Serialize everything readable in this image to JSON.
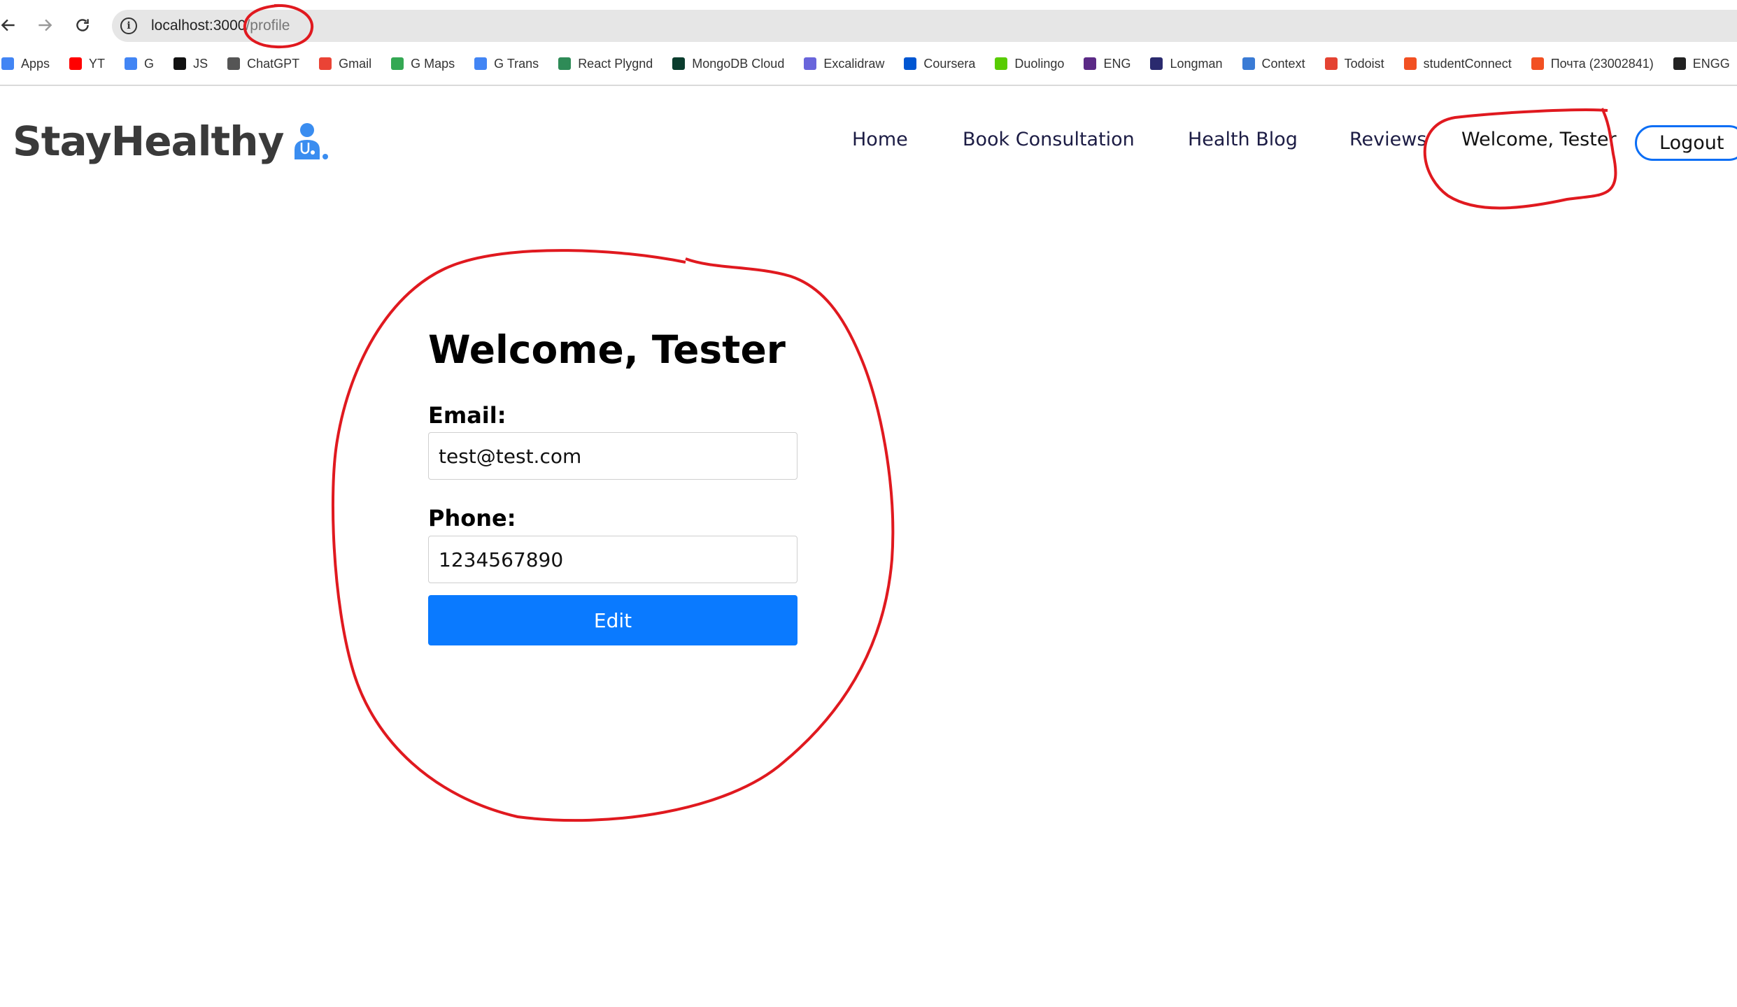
{
  "browser": {
    "url_host": "localhost:3000",
    "url_path": "/profile"
  },
  "bookmarks": [
    {
      "label": "Apps",
      "icon": "apps-grid-icon",
      "color": "#4285f4"
    },
    {
      "label": "YT",
      "icon": "youtube-icon",
      "color": "#ff0000"
    },
    {
      "label": "G",
      "icon": "google-icon",
      "color": "#4285f4"
    },
    {
      "label": "JS",
      "icon": "js-icon",
      "color": "#111111"
    },
    {
      "label": "ChatGPT",
      "icon": "chatgpt-icon",
      "color": "#555555"
    },
    {
      "label": "Gmail",
      "icon": "gmail-icon",
      "color": "#ea4335"
    },
    {
      "label": "G Maps",
      "icon": "maps-pin-icon",
      "color": "#34a853"
    },
    {
      "label": "G Trans",
      "icon": "translate-icon",
      "color": "#4285f4"
    },
    {
      "label": "React Plygnd",
      "icon": "react-playground-icon",
      "color": "#2e8b57"
    },
    {
      "label": "MongoDB Cloud",
      "icon": "mongodb-icon",
      "color": "#0b3d2e"
    },
    {
      "label": "Excalidraw",
      "icon": "excalidraw-icon",
      "color": "#6965db"
    },
    {
      "label": "Coursera",
      "icon": "coursera-icon",
      "color": "#0056d2"
    },
    {
      "label": "Duolingo",
      "icon": "duolingo-icon",
      "color": "#58cc02"
    },
    {
      "label": "ENG",
      "icon": "eng-icon",
      "color": "#5b2a86"
    },
    {
      "label": "Longman",
      "icon": "longman-icon",
      "color": "#2a2a6e"
    },
    {
      "label": "Context",
      "icon": "context-icon",
      "color": "#3a7bd5"
    },
    {
      "label": "Todoist",
      "icon": "todoist-icon",
      "color": "#e44332"
    },
    {
      "label": "studentConnect",
      "icon": "microsoft-icon",
      "color": "#f25022"
    },
    {
      "label": "Почта (23002841)",
      "icon": "microsoft-icon",
      "color": "#f25022"
    },
    {
      "label": "ENGG",
      "icon": "globe-icon",
      "color": "#222222"
    }
  ],
  "site": {
    "brand": "StayHealthy",
    "nav": {
      "home": "Home",
      "book": "Book Consultation",
      "blog": "Health Blog",
      "reviews": "Reviews",
      "welcome": "Welcome, Tester"
    },
    "logout_label": "Logout"
  },
  "profile": {
    "title": "Welcome, Tester",
    "email_label": "Email:",
    "email_value": "test@test.com",
    "phone_label": "Phone:",
    "phone_value": "1234567890",
    "edit_label": "Edit"
  },
  "colors": {
    "primary": "#0a7aff",
    "annotation": "#e0191f",
    "nav_text": "#1c1c44"
  }
}
